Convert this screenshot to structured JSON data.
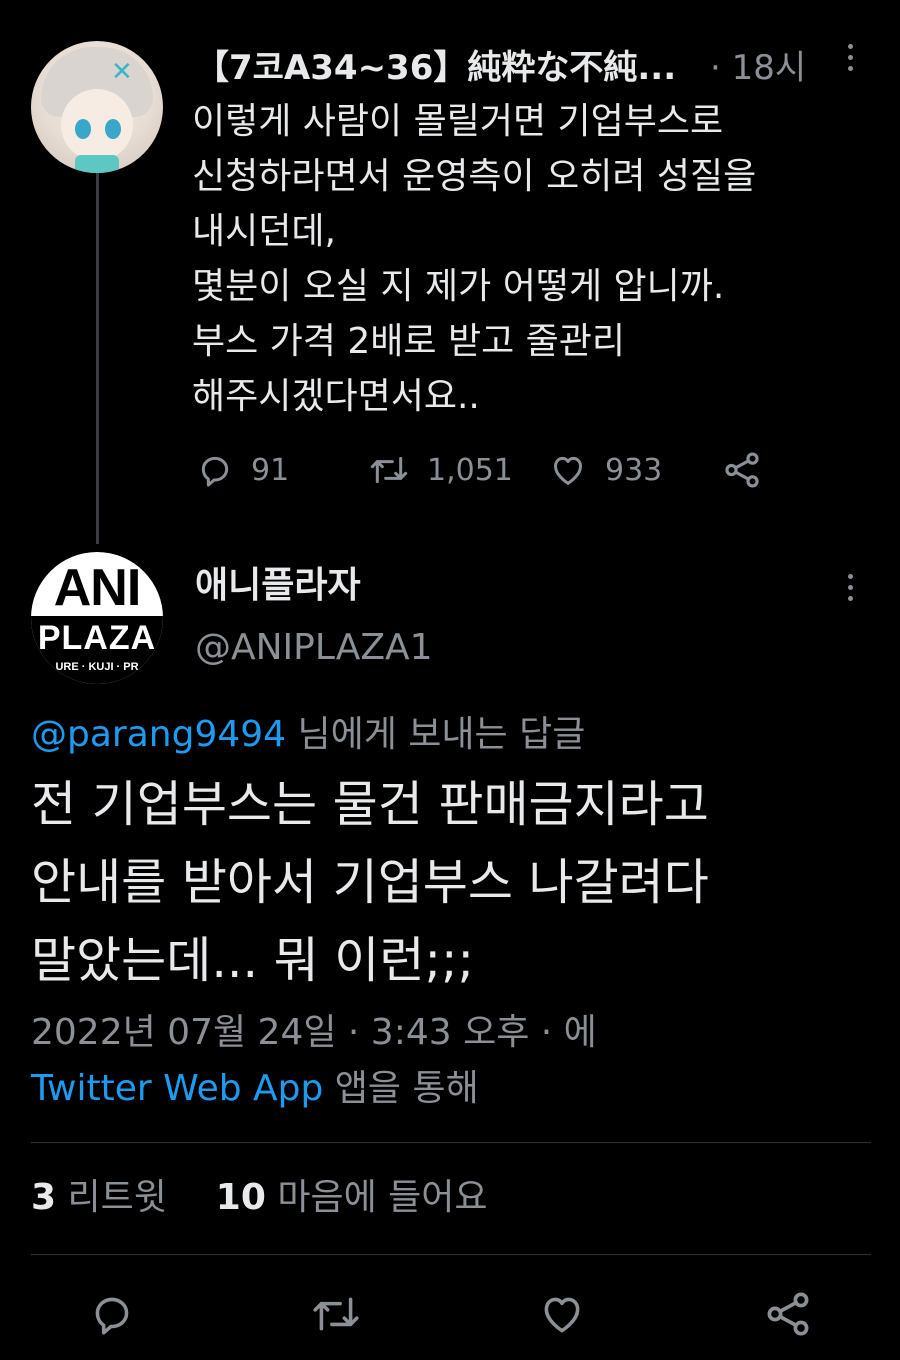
{
  "parent_tweet": {
    "display_name": "【7코A34~36】純粋な不純...",
    "time": "· 18시",
    "text_lines": [
      "이렇게 사람이 몰릴거면 기업부스로",
      "신청하라면서 운영측이 오히려 성질을",
      "내시던데,",
      "몇분이 오실 지 제가 어떻게 압니까.",
      "부스 가격 2배로 받고 줄관리",
      "해주시겠다면서요.."
    ],
    "actions": {
      "replies": "91",
      "retweets": "1,051",
      "likes": "933"
    },
    "icons": [
      "reply-icon",
      "retweet-icon",
      "like-icon",
      "share-icon",
      "more-icon"
    ]
  },
  "reply_tweet": {
    "avatar": {
      "line1": "ANI",
      "line2": "PLAZA",
      "line3": "URE · KUJI · PR"
    },
    "display_name": "애니플라자",
    "handle": "@ANIPLAZA1",
    "reply_to": {
      "mention": "@parang9494",
      "suffix": " 님에게 보내는 답글"
    },
    "text_lines": [
      "전 기업부스는 물건 판매금지라고",
      "안내를 받아서 기업부스 나갈려다",
      "말았는데... 뭐 이런;;;"
    ],
    "date": "2022년 07월 24일 · 3:43 오후 · 에",
    "via": {
      "app": "Twitter Web App",
      "suffix": " 앱을 통해"
    },
    "stats": {
      "retweet_count": "3",
      "retweet_label": " 리트윗",
      "like_count": "10",
      "like_label": " 마음에 들어요"
    }
  },
  "colors": {
    "background": "#000000",
    "text": "#e7e9ea",
    "muted": "#8b9096",
    "accent": "#1d9bf0",
    "divider": "#2f3336"
  }
}
